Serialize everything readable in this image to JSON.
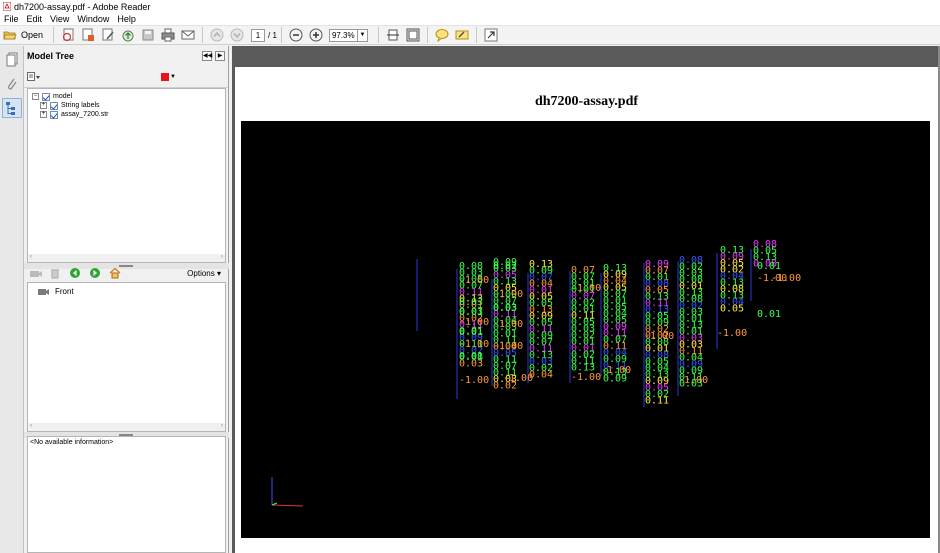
{
  "window": {
    "title": "dh7200-assay.pdf - Adobe Reader"
  },
  "menu": [
    "File",
    "Edit",
    "View",
    "Window",
    "Help"
  ],
  "toolbar": {
    "open_label": "Open",
    "page_current": "1",
    "page_total": "/ 1",
    "zoom": "97.3%"
  },
  "model_tree": {
    "title": "Model Tree",
    "items": [
      {
        "label": "model",
        "level": 0
      },
      {
        "label": "String labels",
        "level": 1
      },
      {
        "label": "assay_7200.str",
        "level": 1
      }
    ]
  },
  "views": {
    "options_label": "Options",
    "items": [
      "Front"
    ]
  },
  "info": {
    "text": "<No available information>"
  },
  "document": {
    "title": "dh7200-assay.pdf"
  },
  "colors": {
    "accent_red": "#e8141a",
    "nav_green": "#2fa534",
    "series_green": "#39ff4a",
    "series_yellow": "#ffe83a",
    "series_orange": "#ff9a3a",
    "series_magenta": "#e43cff",
    "series_blue": "#3a53ff"
  }
}
